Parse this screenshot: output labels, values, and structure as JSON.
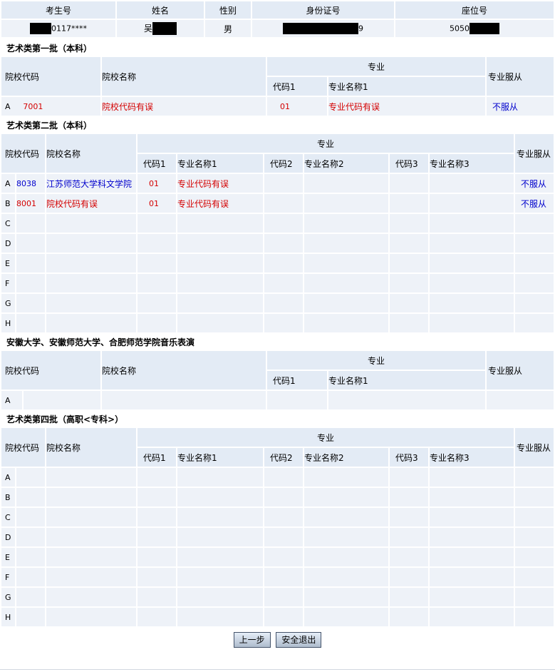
{
  "student": {
    "headers": [
      "考生号",
      "姓名",
      "性别",
      "身份证号",
      "座位号"
    ],
    "exam_no_suffix": "0117****",
    "name_visible": "吴",
    "gender": "男",
    "id_suffix": "9",
    "seat_prefix": "5050"
  },
  "common": {
    "school_code": "院校代码",
    "school_name": "院校名称",
    "major": "专业",
    "obey": "专业服从",
    "code1": "代码1",
    "name1": "专业名称1",
    "code2": "代码2",
    "name2": "专业名称2",
    "code3": "代码3",
    "name3": "专业名称3"
  },
  "sec1": {
    "title": "艺术类第一批（本科）",
    "row": {
      "letter": "A",
      "code": "7001",
      "name": "院校代码有误",
      "m_code": "01",
      "m_name": "专业代码有误",
      "obey": "不服从"
    }
  },
  "sec2": {
    "title": "艺术类第二批（本科）",
    "rows": [
      {
        "letter": "A",
        "code": "8038",
        "name": "江苏师范大学科文学院",
        "m_code": "01",
        "m_name": "专业代码有误",
        "obey": "不服从"
      },
      {
        "letter": "B",
        "code": "8001",
        "name": "院校代码有误",
        "m_code": "01",
        "m_name": "专业代码有误",
        "obey": "不服从"
      },
      {
        "letter": "C"
      },
      {
        "letter": "D"
      },
      {
        "letter": "E"
      },
      {
        "letter": "F"
      },
      {
        "letter": "G"
      },
      {
        "letter": "H"
      }
    ]
  },
  "sec3": {
    "title": "安徽大学、安徽师范大学、合肥师范学院音乐表演",
    "row": {
      "letter": "A"
    }
  },
  "sec4": {
    "title": "艺术类第四批（高职<专科>）",
    "rows": [
      {
        "letter": "A"
      },
      {
        "letter": "B"
      },
      {
        "letter": "C"
      },
      {
        "letter": "D"
      },
      {
        "letter": "E"
      },
      {
        "letter": "F"
      },
      {
        "letter": "G"
      },
      {
        "letter": "H"
      }
    ]
  },
  "buttons": {
    "prev": "上一步",
    "logout": "安全退出"
  }
}
